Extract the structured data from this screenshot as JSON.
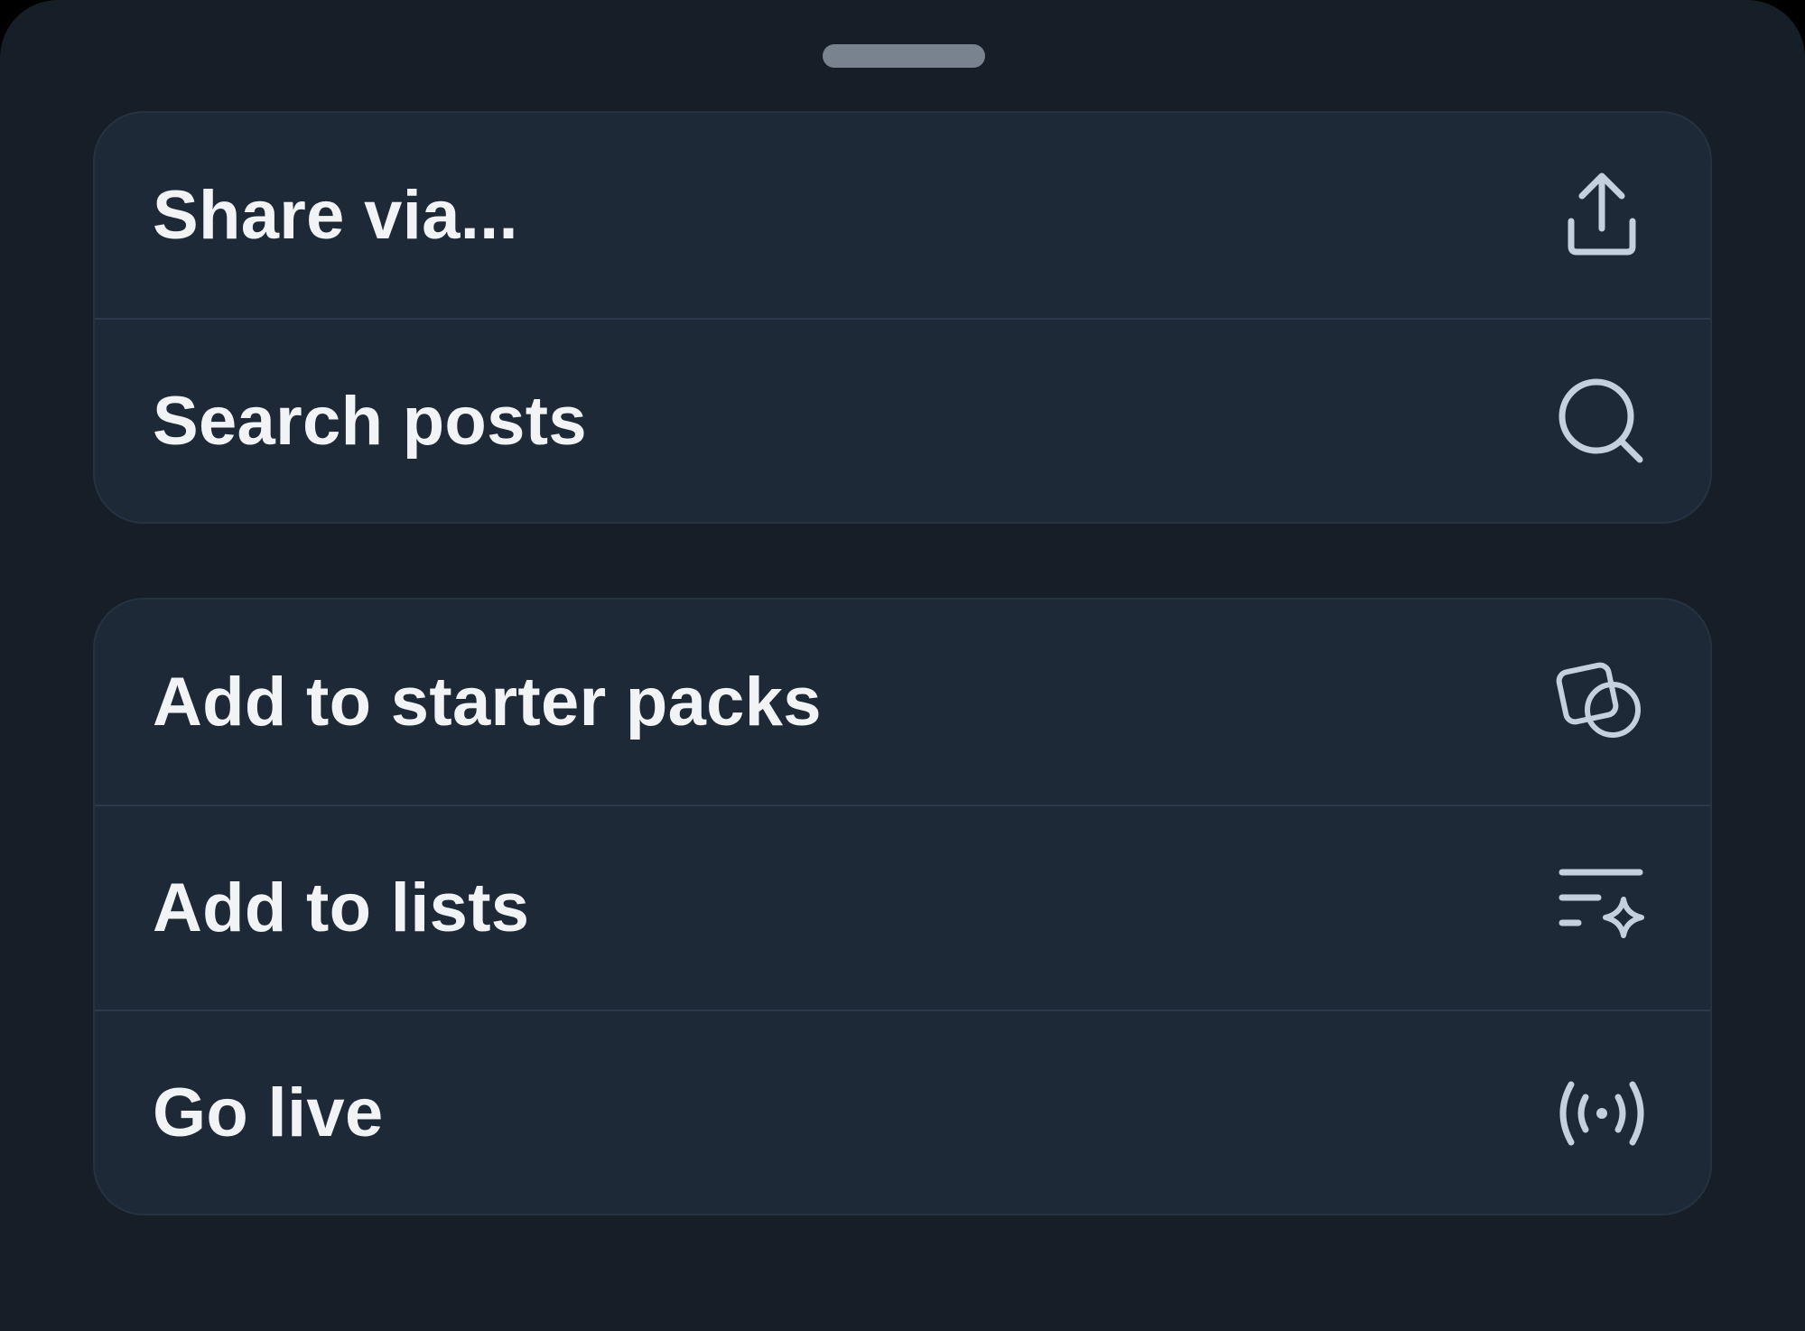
{
  "sheet": {
    "handle": "drag-handle",
    "groups": [
      {
        "items": [
          {
            "label": "Share via...",
            "icon": "share-icon"
          },
          {
            "label": "Search posts",
            "icon": "search-icon"
          }
        ]
      },
      {
        "items": [
          {
            "label": "Add to starter packs",
            "icon": "starter-pack-icon"
          },
          {
            "label": "Add to lists",
            "icon": "list-sparkle-icon"
          },
          {
            "label": "Go live",
            "icon": "broadcast-icon"
          }
        ]
      }
    ]
  },
  "colors": {
    "sheet_background": "#161e27",
    "group_background": "#1d2937",
    "text": "#f1f3f5",
    "icon": "#c4d0de",
    "handle": "#798390"
  }
}
